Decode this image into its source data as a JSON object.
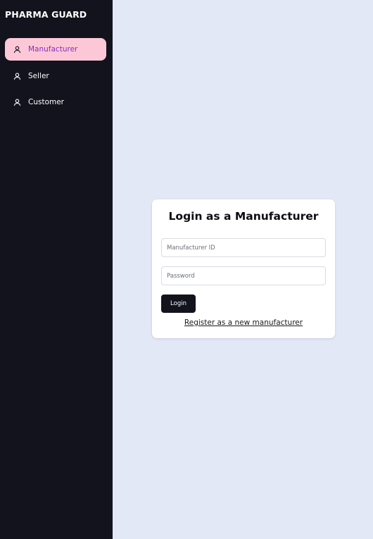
{
  "sidebar": {
    "brand": "PHARMA GUARD",
    "items": [
      {
        "label": "Manufacturer",
        "icon": "user-icon",
        "active": true
      },
      {
        "label": "Seller",
        "icon": "user-icon",
        "active": false
      },
      {
        "label": "Customer",
        "icon": "user-icon",
        "active": false
      }
    ]
  },
  "login": {
    "title": "Login as a Manufacturer",
    "id_placeholder": "Manufacturer ID",
    "id_value": "",
    "password_placeholder": "Password",
    "password_value": "",
    "button_label": "Login",
    "register_link": "Register as a new manufacturer"
  },
  "colors": {
    "sidebar_bg": "#12131d",
    "page_bg": "#e3e8f6",
    "active_item_bg": "#fcc8d8",
    "active_item_text": "#8a2bc2",
    "button_bg": "#12131d"
  }
}
